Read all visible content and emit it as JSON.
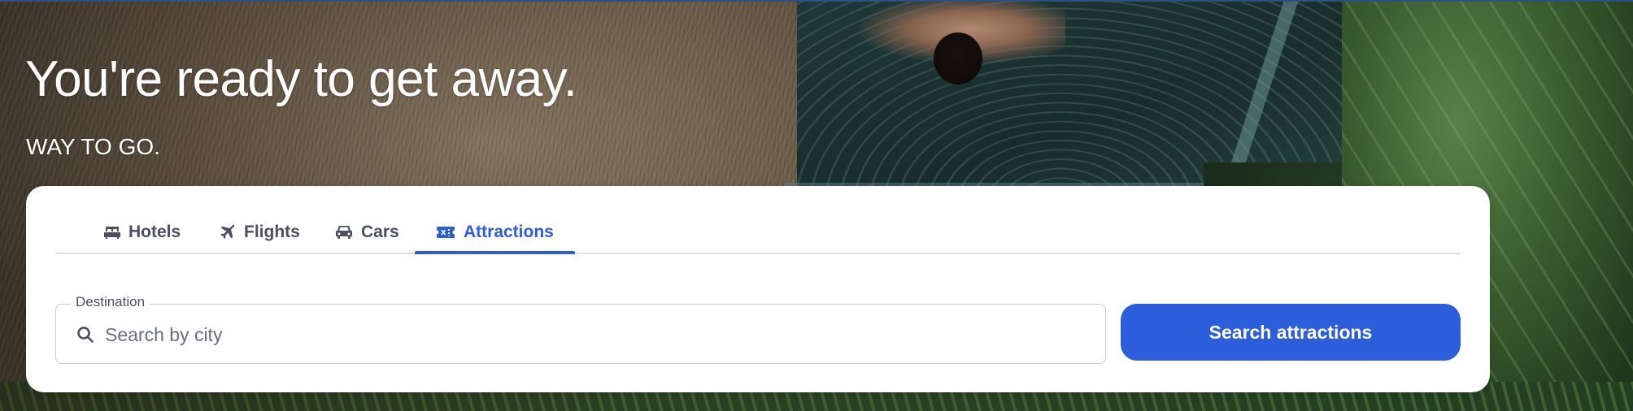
{
  "hero": {
    "headline": "You're ready to get away.",
    "subheadline": "WAY TO GO."
  },
  "tabs": [
    {
      "label": "Hotels",
      "icon": "bed-icon",
      "active": false
    },
    {
      "label": "Flights",
      "icon": "airplane-icon",
      "active": false
    },
    {
      "label": "Cars",
      "icon": "car-icon",
      "active": false
    },
    {
      "label": "Attractions",
      "icon": "ticket-icon",
      "active": true
    }
  ],
  "search": {
    "destination_label": "Destination",
    "placeholder": "Search by city",
    "value": "",
    "button_label": "Search attractions"
  },
  "colors": {
    "accent": "#2c5ddb",
    "tab_text": "#4b4f60",
    "card_background": "#ffffff"
  }
}
